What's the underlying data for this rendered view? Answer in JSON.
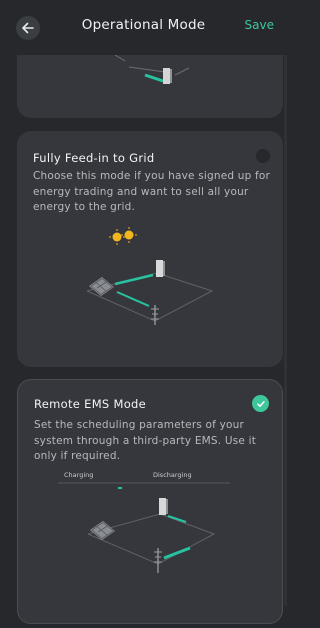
{
  "header": {
    "title": "Operational Mode",
    "save_label": "Save"
  },
  "icons": {
    "back": "arrow-left-icon",
    "selected": "checkmark-icon",
    "sun": "sun-icon"
  },
  "colors": {
    "accent": "#3ec79a",
    "background": "#26282c",
    "card": "#35373c"
  },
  "modes": [
    {
      "title": "Fully Feed-in to Grid",
      "description": "Choose this mode if you have signed up for energy trading and want to sell all your energy to the grid.",
      "selected": false
    },
    {
      "title": "Remote EMS Mode",
      "description": "Set the scheduling parameters of your system through a third-party EMS. Use it only if required.",
      "selected": true,
      "legend": {
        "charging": "Charging",
        "discharging": "Discharging"
      }
    }
  ]
}
